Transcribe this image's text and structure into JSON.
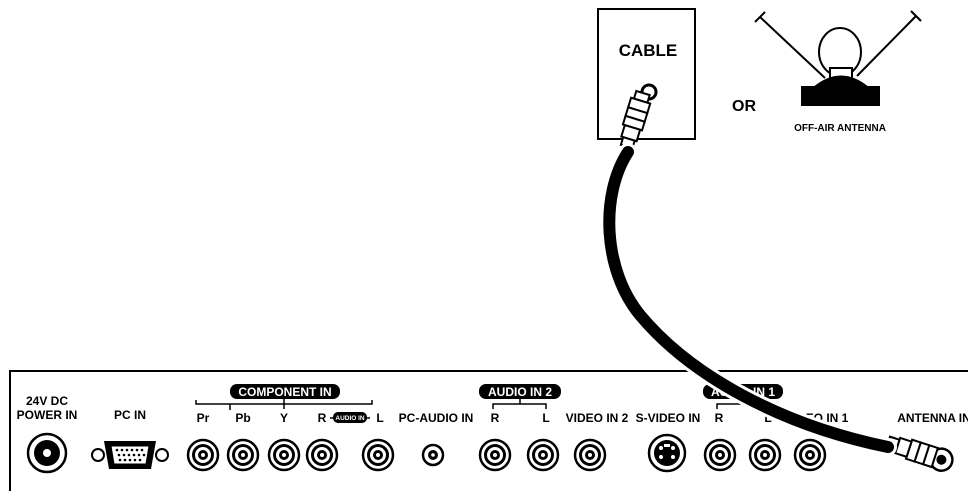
{
  "source": {
    "cable_label": "CABLE",
    "or_label": "OR",
    "antenna_label": "OFF-AIR ANTENNA"
  },
  "panel": {
    "groups": {
      "component_in": "COMPONENT IN",
      "audio_in_small": "AUDIO IN",
      "audio_in_2": "AUDIO IN 2",
      "audio_in_1": "AUDIO IN 1"
    },
    "labels": {
      "power_line1": "24V DC",
      "power_line2": "POWER IN",
      "pc_in": "PC IN",
      "pr": "Pr",
      "pb": "Pb",
      "y": "Y",
      "comp_r": "R",
      "comp_l": "L",
      "pc_audio_in": "PC-AUDIO IN",
      "a2_r": "R",
      "a2_l": "L",
      "video_in_2": "VIDEO IN 2",
      "s_video_in": "S-VIDEO IN",
      "a1_r": "R",
      "a1_l": "L",
      "video_in_1": "VIDEO IN 1",
      "antenna_in": "ANTENNA IN"
    }
  },
  "colors": {
    "ink": "#000000",
    "paper": "#ffffff"
  }
}
